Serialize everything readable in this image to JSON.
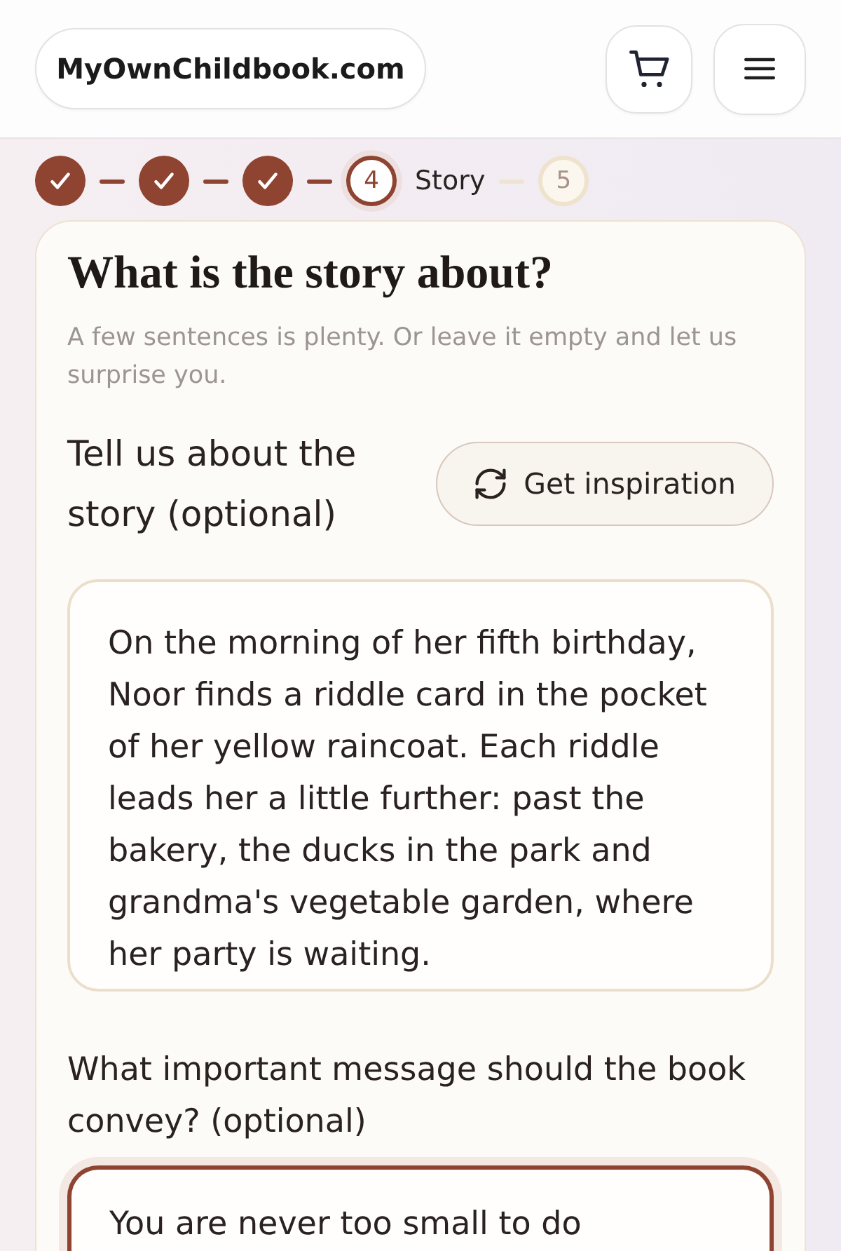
{
  "header": {
    "logo": "MyOwnChildbook.com"
  },
  "steps": [
    {
      "completed": true,
      "current": false
    },
    {
      "completed": true,
      "current": false
    },
    {
      "completed": true,
      "current": false
    },
    {
      "completed": false,
      "current": true,
      "number": "4",
      "label": "Story"
    },
    {
      "completed": false,
      "current": false,
      "number": "5"
    }
  ],
  "card": {
    "title": "What is the story about?",
    "subtitle": "A few sentences is plenty. Or leave it empty and let us surprise you.",
    "fields": [
      {
        "label": "Tell us about the story (optional)",
        "button": "Get inspiration",
        "value": "On the morning of her fifth birthday, Noor finds a riddle card in the pocket of her yellow raincoat. Each riddle leads her a little further: past the bakery, the ducks in the park and grandma's vegetable garden, where her party is waiting.",
        "focused": false
      },
      {
        "label": "What important message should the book convey? (optional)",
        "value": "You are never too small to do",
        "focused": true
      }
    ]
  }
}
